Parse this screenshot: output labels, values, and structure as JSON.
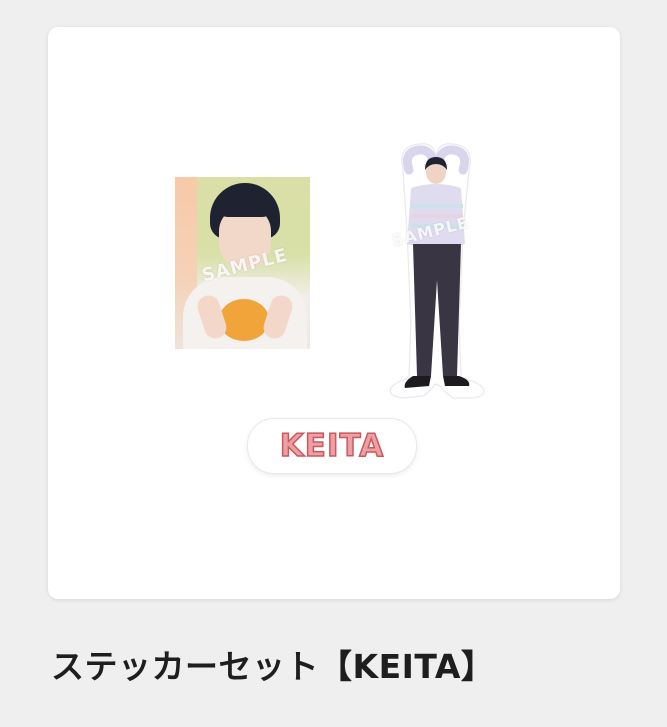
{
  "product": {
    "title": "ステッカーセット【KEITA】",
    "stickers": [
      {
        "kind": "photo",
        "watermark": "SAMPLE"
      },
      {
        "kind": "full-body",
        "watermark": "SAMPLE"
      },
      {
        "kind": "name",
        "text": "KEITA"
      }
    ]
  },
  "colors": {
    "background": "#efefef",
    "card": "#ffffff",
    "name_fill": "#eda0a2",
    "name_stroke": "#c9585f",
    "title_text": "#1e1e1e"
  }
}
